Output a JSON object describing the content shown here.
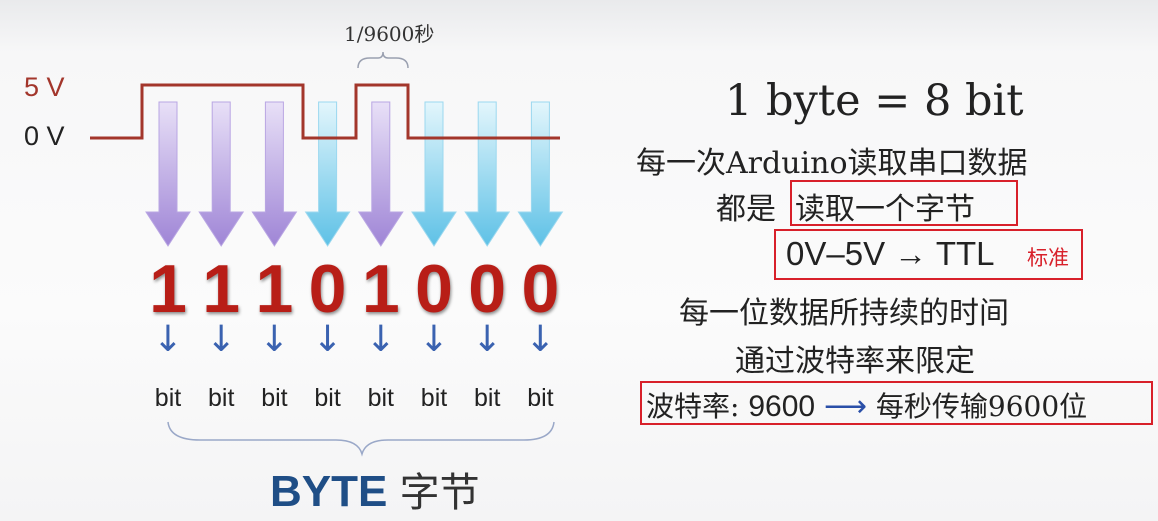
{
  "signal": {
    "high_label": "5 V",
    "low_label": "0 V",
    "period_label": "1/9600秒",
    "line_color": "#a3362b"
  },
  "bits": [
    {
      "digit": "1",
      "label": "bit",
      "arrow": "purple"
    },
    {
      "digit": "1",
      "label": "bit",
      "arrow": "purple"
    },
    {
      "digit": "1",
      "label": "bit",
      "arrow": "purple"
    },
    {
      "digit": "0",
      "label": "bit",
      "arrow": "cyan"
    },
    {
      "digit": "1",
      "label": "bit",
      "arrow": "purple"
    },
    {
      "digit": "0",
      "label": "bit",
      "arrow": "cyan"
    },
    {
      "digit": "0",
      "label": "bit",
      "arrow": "cyan"
    },
    {
      "digit": "0",
      "label": "bit",
      "arrow": "cyan"
    }
  ],
  "byte_label": {
    "en": "BYTE",
    "zh": "字节"
  },
  "notes": {
    "heading": "1 byte = 8 bit",
    "line1": "每一次Arduino读取串口数据",
    "line2_prefix": "都是",
    "line2_boxed": "读取一个字节",
    "ttl_main": "0V–5V → TTL",
    "ttl_suffix": "标准",
    "line4": "每一位数据所持续的时间",
    "line5": "通过波特率来限定",
    "baud_prefix": "波特率:",
    "baud_value": "9600",
    "baud_arrow": "⟶",
    "baud_suffix": "每秒传输9600位"
  },
  "colors": {
    "highlight_box": "#d8202a",
    "digit": "#b81e17",
    "byte_text": "#1f4e86",
    "down_arrow": "#3a62b0"
  }
}
